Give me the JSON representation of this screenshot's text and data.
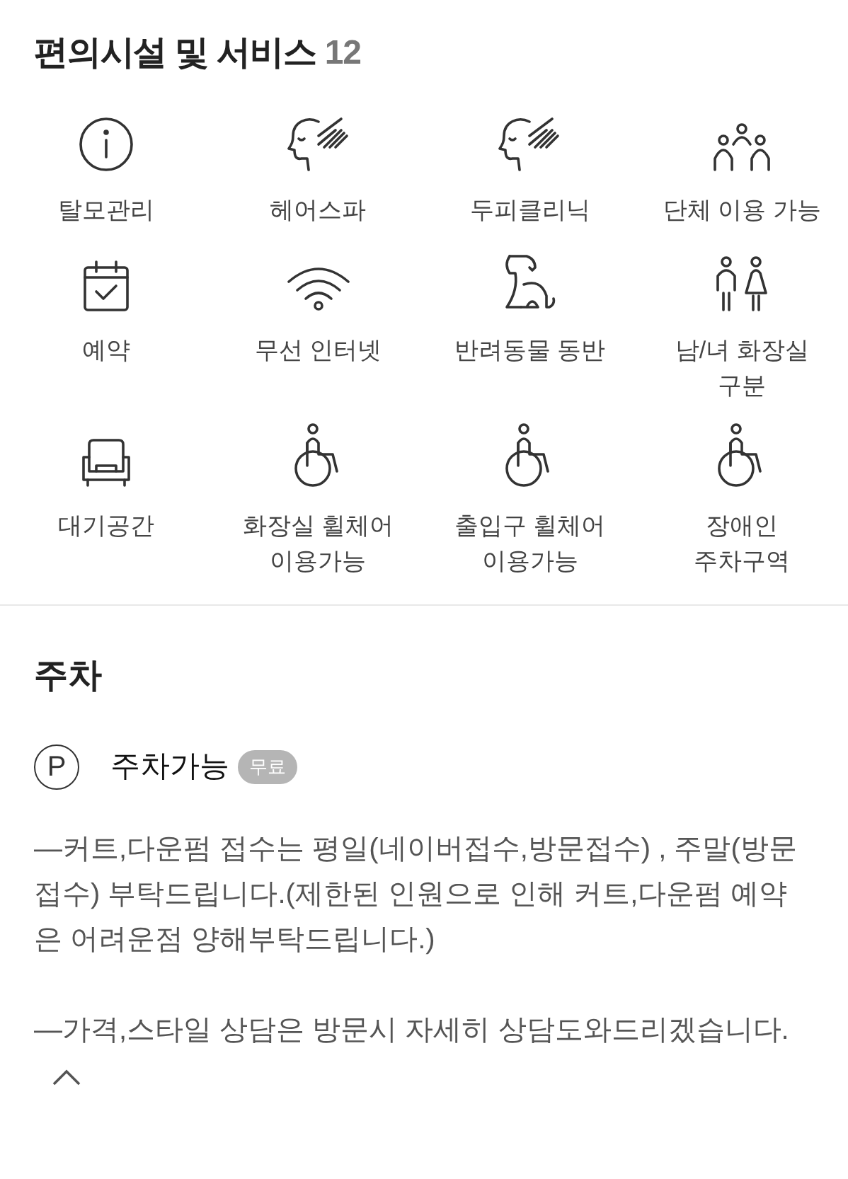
{
  "facilities": {
    "title": "편의시설 및 서비스",
    "count": "12",
    "items": [
      {
        "kind": "info",
        "label": "탈모관리"
      },
      {
        "kind": "face",
        "label": "헤어스파"
      },
      {
        "kind": "face",
        "label": "두피클리닉"
      },
      {
        "kind": "group",
        "label": "단체 이용 가능"
      },
      {
        "kind": "calendar",
        "label": "예약"
      },
      {
        "kind": "wifi",
        "label": "무선 인터넷"
      },
      {
        "kind": "dog",
        "label": "반려동물 동반"
      },
      {
        "kind": "restroom",
        "label": "남/녀 화장실 구분"
      },
      {
        "kind": "armchair",
        "label": "대기공간"
      },
      {
        "kind": "wheelchair",
        "label": "화장실 휠체어 이용가능"
      },
      {
        "kind": "wheelchair",
        "label": "출입구 휠체어 이용가능"
      },
      {
        "kind": "wheelchair",
        "label": "장애인 주차구역"
      }
    ]
  },
  "parking": {
    "title": "주차",
    "icon_letter": "P",
    "status": "주차가능",
    "badge": "무료",
    "notes": [
      "—커트,다운펌 접수는 평일(네이버접수,방문접수) , 주말(방문접수) 부탁드립니다.(제한된 인원으로 인해 커트,다운펌 예약은 어려운점 양해부탁드립니다.)",
      "—가격,스타일 상담은 방문시 자세히 상담도와드리겠습니다."
    ],
    "expanded": true
  }
}
